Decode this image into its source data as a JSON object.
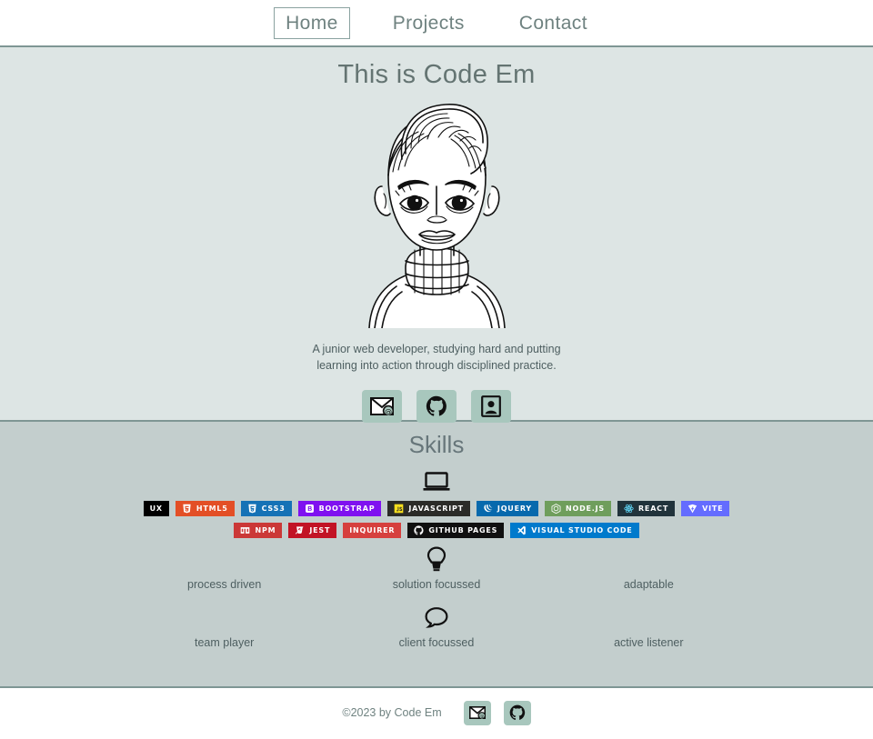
{
  "nav": {
    "items": [
      {
        "label": "Home",
        "active": true
      },
      {
        "label": "Projects",
        "active": false
      },
      {
        "label": "Contact",
        "active": false
      }
    ]
  },
  "hero": {
    "title": "This is Code Em",
    "avatar_alt": "line-art portrait illustration of a person with a top-knot bun and turtleneck sweater",
    "bio_line1": "A junior web developer, studying hard and putting",
    "bio_line2": "learning into action through disciplined practice.",
    "social": [
      {
        "name": "email-icon",
        "label": "Email"
      },
      {
        "name": "github-icon",
        "label": "GitHub"
      },
      {
        "name": "portfolio-card-icon",
        "label": "Portfolio"
      }
    ]
  },
  "skills": {
    "title": "Skills",
    "laptop_icon": "laptop-icon",
    "badges_row1": [
      {
        "label": "UX",
        "bg": "#000000",
        "fg": "#ffffff",
        "icon": "none"
      },
      {
        "label": "HTML5",
        "bg": "#e34f26",
        "fg": "#ffffff",
        "icon": "html5-shield"
      },
      {
        "label": "CSS3",
        "bg": "#1572b6",
        "fg": "#ffffff",
        "icon": "css3-shield"
      },
      {
        "label": "BOOTSTRAP",
        "bg": "#7f11f0",
        "fg": "#ffffff",
        "icon": "bootstrap-b"
      },
      {
        "label": "JAVASCRIPT",
        "bg": "#2b2b28",
        "fg": "#ffffff",
        "icon": "js-square"
      },
      {
        "label": "JQUERY",
        "bg": "#0769ad",
        "fg": "#ffffff",
        "icon": "jquery-swirl"
      },
      {
        "label": "NODE.JS",
        "bg": "#6f9e5c",
        "fg": "#ffffff",
        "icon": "node-hex"
      },
      {
        "label": "REACT",
        "bg": "#21333b",
        "fg": "#ffffff",
        "icon": "react-atom"
      },
      {
        "label": "VITE",
        "bg": "#646cff",
        "fg": "#ffffff",
        "icon": "vite-bolt"
      }
    ],
    "badges_row2": [
      {
        "label": "NPM",
        "bg": "#cb3837",
        "fg": "#ffffff",
        "icon": "npm-box"
      },
      {
        "label": "JEST",
        "bg": "#c21325",
        "fg": "#ffffff",
        "icon": "jest-torch"
      },
      {
        "label": "INQUIRER",
        "bg": "#d6403e",
        "fg": "#ffffff",
        "icon": "none"
      },
      {
        "label": "GITHUB PAGES",
        "bg": "#101010",
        "fg": "#ffffff",
        "icon": "github-mark"
      },
      {
        "label": "VISUAL STUDIO CODE",
        "bg": "#007acc",
        "fg": "#ffffff",
        "icon": "vscode-fold"
      }
    ],
    "soft_skills": [
      {
        "label": "process driven",
        "icon": "none"
      },
      {
        "label": "solution focussed",
        "icon": "lightbulb-icon"
      },
      {
        "label": "adaptable",
        "icon": "none"
      },
      {
        "label": "team player",
        "icon": "none"
      },
      {
        "label": "client focussed",
        "icon": "speech-bubble-icon"
      },
      {
        "label": "active listener",
        "icon": "none"
      }
    ]
  },
  "footer": {
    "copyright": "©2023 by Code Em",
    "social": [
      {
        "name": "email-icon",
        "label": "Email"
      },
      {
        "name": "github-icon",
        "label": "GitHub"
      }
    ]
  },
  "colors": {
    "hero_bg": "#dde5e4",
    "skills_bg": "#c3cecd",
    "footer_bg": "#ffffff",
    "divider": "#7e9694",
    "icon_button_bg": "#a8c7bd",
    "nav_text": "#6f8280",
    "body_text": "#4e5f61"
  }
}
